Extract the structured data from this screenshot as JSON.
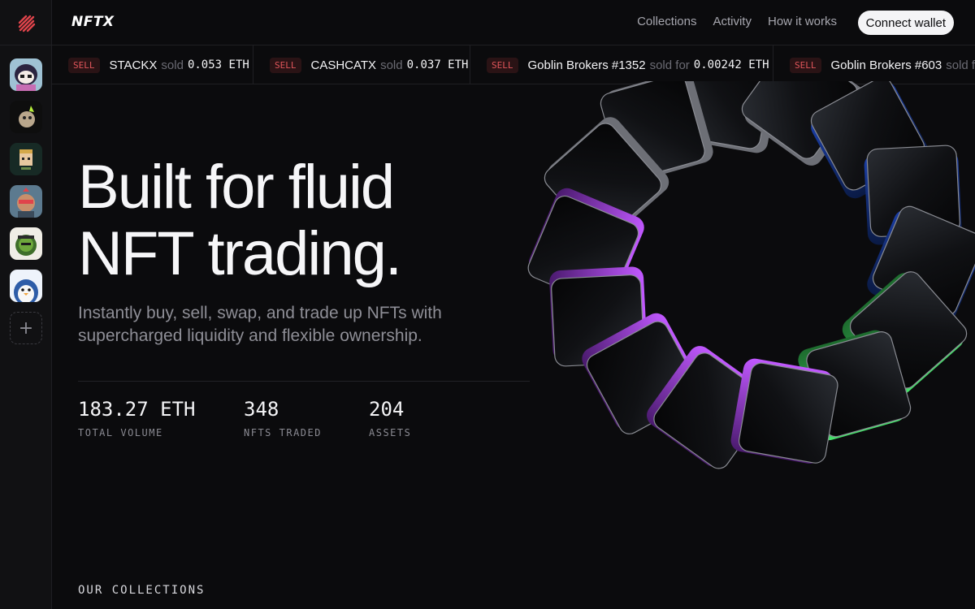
{
  "brand": {
    "name": "NFTX"
  },
  "nav": {
    "items": [
      "Collections",
      "Activity",
      "How it works"
    ],
    "connect_label": "Connect wallet"
  },
  "rail": {
    "collections": [
      "collection-1",
      "collection-2",
      "collection-3",
      "collection-4",
      "collection-5",
      "collection-6"
    ],
    "add_symbol": "+"
  },
  "ticker": [
    {
      "badge": "SELL",
      "name": "STACKX",
      "verb": "sold",
      "price": "0.053 ETH"
    },
    {
      "badge": "SELL",
      "name": "CASHCATX",
      "verb": "sold",
      "price": "0.037 ETH"
    },
    {
      "badge": "SELL",
      "name": "Goblin Brokers #1352",
      "verb": "sold for",
      "price": "0.00242 ETH"
    },
    {
      "badge": "SELL",
      "name": "Goblin Brokers #603",
      "verb": "sold f",
      "price": ""
    }
  ],
  "hero": {
    "title_line1": "Built for fluid",
    "title_line2": "NFT trading.",
    "subtitle": "Instantly buy, sell, swap, and trade up NFTs with supercharged liquidity and flexible ownership."
  },
  "stats": [
    {
      "value": "183.27 ETH",
      "label": "TOTAL VOLUME"
    },
    {
      "value": "348",
      "label": "NFTS TRADED"
    },
    {
      "value": "204",
      "label": "ASSETS"
    }
  ],
  "section": {
    "collections_label": "OUR COLLECTIONS"
  },
  "colors": {
    "background": "#0b0b0d",
    "sell_red": "#e0555a",
    "accent_purple": "#a24ad6",
    "accent_green": "#2ecc71"
  }
}
